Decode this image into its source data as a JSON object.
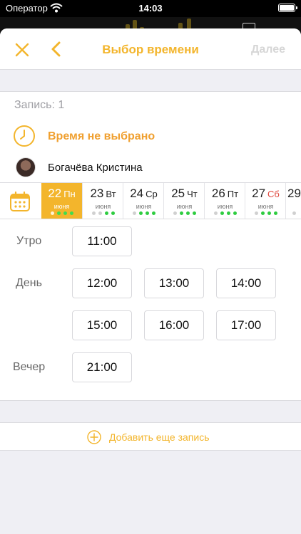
{
  "status_bar": {
    "carrier": "Оператор",
    "time": "14:03"
  },
  "nav": {
    "title": "Выбор времени",
    "next_label": "Далее"
  },
  "record": {
    "label": "Запись: 1"
  },
  "booking": {
    "time_status": "Время не выбрано",
    "master_name": "Богачёва Кристина"
  },
  "days": [
    {
      "num": "22",
      "dow": "Пн",
      "month": "июня",
      "selected": true,
      "weekend": false,
      "dots": [
        "grey",
        "green",
        "green",
        "green"
      ]
    },
    {
      "num": "23",
      "dow": "Вт",
      "month": "июня",
      "selected": false,
      "weekend": false,
      "dots": [
        "grey",
        "grey",
        "green",
        "green"
      ]
    },
    {
      "num": "24",
      "dow": "Ср",
      "month": "июня",
      "selected": false,
      "weekend": false,
      "dots": [
        "grey",
        "green",
        "green",
        "green"
      ]
    },
    {
      "num": "25",
      "dow": "Чт",
      "month": "июня",
      "selected": false,
      "weekend": false,
      "dots": [
        "grey",
        "green",
        "green",
        "green"
      ]
    },
    {
      "num": "26",
      "dow": "Пт",
      "month": "июня",
      "selected": false,
      "weekend": false,
      "dots": [
        "grey",
        "green",
        "green",
        "green"
      ]
    },
    {
      "num": "27",
      "dow": "Сб",
      "month": "июня",
      "selected": false,
      "weekend": true,
      "dots": [
        "grey",
        "green",
        "green",
        "green"
      ]
    },
    {
      "num": "29",
      "dow": "",
      "month": "",
      "selected": false,
      "weekend": false,
      "dots": [
        "grey"
      ]
    }
  ],
  "periods": {
    "morning": {
      "label": "Утро",
      "slots": [
        "11:00"
      ]
    },
    "day": {
      "label": "День",
      "slots": [
        "12:00",
        "13:00",
        "14:00",
        "15:00",
        "16:00",
        "17:00"
      ]
    },
    "evening": {
      "label": "Вечер",
      "slots": [
        "21:00"
      ]
    }
  },
  "add_record": {
    "label": "Добавить еще запись"
  },
  "colors": {
    "accent": "#f3b52c",
    "time_status": "#f0a030",
    "available_dot": "#2ecc40",
    "weekend": "#e0493f",
    "disabled": "#d6d6d6"
  },
  "icons": {
    "close": "close-icon",
    "back": "chevron-left-icon",
    "clock": "clock-icon",
    "calendar": "calendar-icon",
    "add": "plus-circle-icon",
    "wifi": "wifi-icon",
    "battery": "battery-icon"
  }
}
